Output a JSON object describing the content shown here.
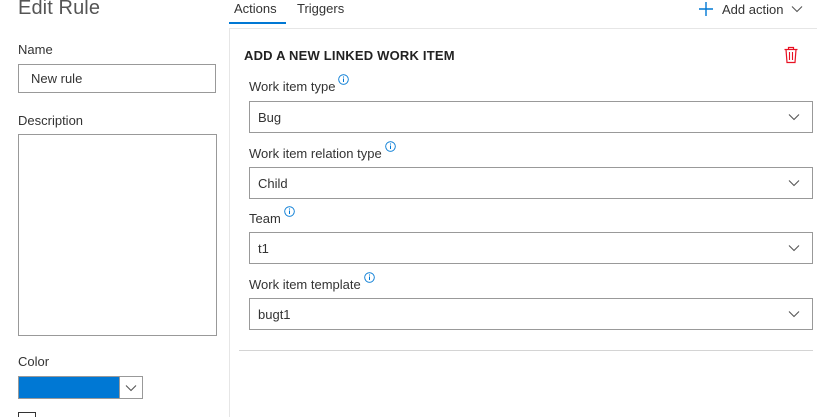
{
  "header": {
    "title": "Edit Rule",
    "tabs": [
      {
        "label": "Actions",
        "selected": true
      },
      {
        "label": "Triggers",
        "selected": false
      }
    ],
    "add_action_label": "Add action"
  },
  "left": {
    "name_label": "Name",
    "name_value": "New rule",
    "description_label": "Description",
    "description_value": "",
    "color_label": "Color",
    "color_value": "#0078d4"
  },
  "action": {
    "title": "ADD A NEW LINKED WORK ITEM",
    "fields": [
      {
        "label": "Work item type",
        "value": "Bug"
      },
      {
        "label": "Work item relation type",
        "value": "Child"
      },
      {
        "label": "Team",
        "value": "t1"
      },
      {
        "label": "Work item template",
        "value": "bugt1"
      }
    ]
  },
  "colors": {
    "accent": "#0078d4",
    "delete": "#e81123",
    "border": "#999999"
  }
}
